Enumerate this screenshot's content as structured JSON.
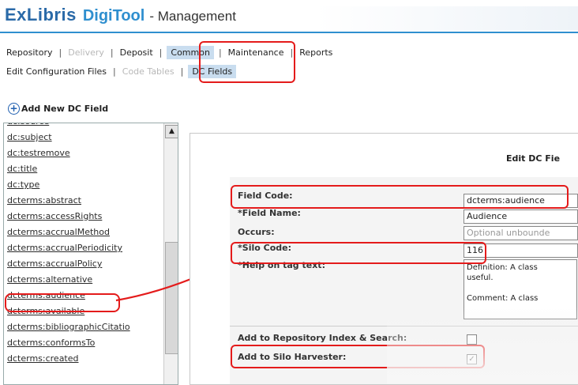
{
  "header": {
    "brand_exlibris": "ExLibris",
    "brand_digitool": "DigiTool",
    "brand_management": "- Management"
  },
  "nav": {
    "row1": [
      {
        "label": "Repository",
        "state": "normal"
      },
      {
        "label": "Delivery",
        "state": "disabled"
      },
      {
        "label": "Deposit",
        "state": "normal"
      },
      {
        "label": "Common",
        "state": "active"
      },
      {
        "label": "Maintenance",
        "state": "normal"
      },
      {
        "label": "Reports",
        "state": "normal"
      }
    ],
    "row2": [
      {
        "label": "Edit Configuration Files",
        "state": "normal"
      },
      {
        "label": "Code Tables",
        "state": "disabled"
      },
      {
        "label": "DC Fields",
        "state": "active"
      }
    ]
  },
  "add_new": {
    "label": "Add New DC Field"
  },
  "field_list": [
    "dc:subject",
    "dc:testremove",
    "dc:title",
    "dc:type",
    "dcterms:abstract",
    "dcterms:accessRights",
    "dcterms:accrualMethod",
    "dcterms:accrualPeriodicity",
    "dcterms:accrualPolicy",
    "dcterms:alternative",
    "dcterms:audience",
    "dcterms:available",
    "dcterms:bibliographicCitatio",
    "dcterms:conformsTo",
    "dcterms:created"
  ],
  "form": {
    "title": "Edit DC Fie",
    "field_code": {
      "label": "Field Code:",
      "value": "dcterms:audience"
    },
    "field_name": {
      "label": "*Field Name:",
      "value": "Audience"
    },
    "occurs": {
      "label": "Occurs:",
      "value": "Optional unbounde"
    },
    "silo_code": {
      "label": "Silo Code:",
      "value": "116",
      "asterisk": "*"
    },
    "help_text": {
      "label": "*Help on tag text:",
      "line1": "Definition:  A class",
      "line2": "useful.",
      "line3": "Comment:  A class"
    },
    "add_repository": {
      "label": "Add to Repository Index & Search:",
      "checked": false
    },
    "add_silo": {
      "label": "Add to Silo Harvester:",
      "checked": true,
      "checkmark": "✓"
    }
  },
  "colors": {
    "accent": "#2f8fcf",
    "highlight": "#c9ddef",
    "annotation": "#e41b1b"
  }
}
